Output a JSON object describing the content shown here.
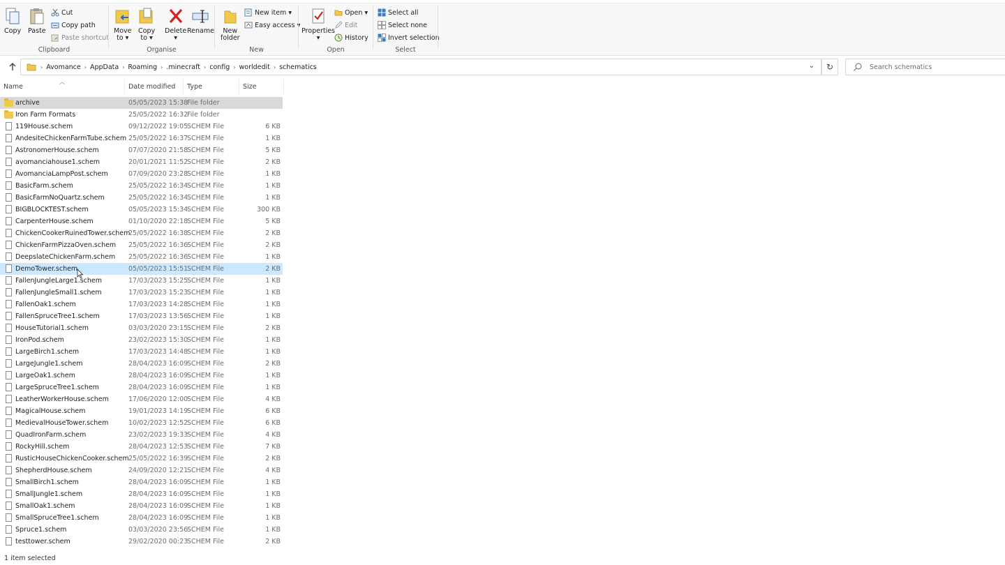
{
  "ribbon": {
    "clipboard": {
      "label": "Clipboard",
      "copy": "Copy",
      "paste": "Paste",
      "cut": "Cut",
      "copy_path": "Copy path",
      "paste_shortcut": "Paste shortcut"
    },
    "organise": {
      "label": "Organise",
      "move_to": "Move\nto",
      "move_to_l1": "Move",
      "move_to_l2": "to ▾",
      "copy_to_l1": "Copy",
      "copy_to_l2": "to ▾",
      "delete_l1": "Delete",
      "delete_l2": "▾",
      "rename": "Rename"
    },
    "new": {
      "label": "New",
      "new_folder_l1": "New",
      "new_folder_l2": "folder",
      "new_item": "New item ▾",
      "easy_access": "Easy access ▾"
    },
    "open": {
      "label": "Open",
      "properties_l1": "Properties",
      "properties_l2": "▾",
      "open": "Open ▾",
      "edit": "Edit",
      "history": "History"
    },
    "select": {
      "label": "Select",
      "select_all": "Select all",
      "select_none": "Select none",
      "invert_selection": "Invert selection"
    }
  },
  "address": {
    "crumbs": [
      "Avomance",
      "AppData",
      "Roaming",
      ".minecraft",
      "config",
      "worldedit",
      "schematics"
    ],
    "separator": "›"
  },
  "search": {
    "placeholder": "Search schematics"
  },
  "columns": {
    "name": "Name",
    "date": "Date modified",
    "type": "Type",
    "size": "Size"
  },
  "files": [
    {
      "name": "archive",
      "date": "05/05/2023 15:38",
      "type": "File folder",
      "size": "",
      "kind": "folder",
      "state": "selected-inactive"
    },
    {
      "name": "Iron Farm Formats",
      "date": "25/05/2022 16:32",
      "type": "File folder",
      "size": "",
      "kind": "folder"
    },
    {
      "name": "119House.schem",
      "date": "09/12/2022 19:05",
      "type": "SCHEM File",
      "size": "6 KB",
      "kind": "file"
    },
    {
      "name": "AndesiteChickenFarmTube.schem",
      "date": "25/05/2022 16:37",
      "type": "SCHEM File",
      "size": "1 KB",
      "kind": "file"
    },
    {
      "name": "AstronomerHouse.schem",
      "date": "07/07/2020 21:58",
      "type": "SCHEM File",
      "size": "5 KB",
      "kind": "file"
    },
    {
      "name": "avomanciahouse1.schem",
      "date": "20/01/2021 11:52",
      "type": "SCHEM File",
      "size": "2 KB",
      "kind": "file"
    },
    {
      "name": "AvomanciaLampPost.schem",
      "date": "07/09/2020 23:28",
      "type": "SCHEM File",
      "size": "1 KB",
      "kind": "file"
    },
    {
      "name": "BasicFarm.schem",
      "date": "25/05/2022 16:34",
      "type": "SCHEM File",
      "size": "1 KB",
      "kind": "file"
    },
    {
      "name": "BasicFarmNoQuartz.schem",
      "date": "25/05/2022 16:34",
      "type": "SCHEM File",
      "size": "1 KB",
      "kind": "file"
    },
    {
      "name": "BIGBLOCKTEST.schem",
      "date": "05/05/2023 15:34",
      "type": "SCHEM File",
      "size": "300 KB",
      "kind": "file"
    },
    {
      "name": "CarpenterHouse.schem",
      "date": "01/10/2020 22:18",
      "type": "SCHEM File",
      "size": "5 KB",
      "kind": "file"
    },
    {
      "name": "ChickenCookerRuinedTower.schem",
      "date": "25/05/2022 16:38",
      "type": "SCHEM File",
      "size": "2 KB",
      "kind": "file"
    },
    {
      "name": "ChickenFarmPizzaOven.schem",
      "date": "25/05/2022 16:36",
      "type": "SCHEM File",
      "size": "2 KB",
      "kind": "file"
    },
    {
      "name": "DeepslateChickenFarm.schem",
      "date": "25/05/2022 16:36",
      "type": "SCHEM File",
      "size": "1 KB",
      "kind": "file"
    },
    {
      "name": "DemoTower.schem",
      "date": "05/05/2023 15:51",
      "type": "SCHEM File",
      "size": "2 KB",
      "kind": "file",
      "state": "hover"
    },
    {
      "name": "FallenJungleLarge1.schem",
      "date": "17/03/2023 15:25",
      "type": "SCHEM File",
      "size": "1 KB",
      "kind": "file"
    },
    {
      "name": "FallenJungleSmall1.schem",
      "date": "17/03/2023 15:23",
      "type": "SCHEM File",
      "size": "1 KB",
      "kind": "file"
    },
    {
      "name": "FallenOak1.schem",
      "date": "17/03/2023 14:28",
      "type": "SCHEM File",
      "size": "1 KB",
      "kind": "file"
    },
    {
      "name": "FallenSpruceTree1.schem",
      "date": "17/03/2023 13:56",
      "type": "SCHEM File",
      "size": "1 KB",
      "kind": "file"
    },
    {
      "name": "HouseTutorial1.schem",
      "date": "03/03/2020 23:15",
      "type": "SCHEM File",
      "size": "2 KB",
      "kind": "file"
    },
    {
      "name": "IronPod.schem",
      "date": "23/02/2023 15:30",
      "type": "SCHEM File",
      "size": "1 KB",
      "kind": "file"
    },
    {
      "name": "LargeBirch1.schem",
      "date": "17/03/2023 14:48",
      "type": "SCHEM File",
      "size": "1 KB",
      "kind": "file"
    },
    {
      "name": "LargeJungle1.schem",
      "date": "28/04/2023 16:09",
      "type": "SCHEM File",
      "size": "2 KB",
      "kind": "file"
    },
    {
      "name": "LargeOak1.schem",
      "date": "28/04/2023 16:09",
      "type": "SCHEM File",
      "size": "1 KB",
      "kind": "file"
    },
    {
      "name": "LargeSpruceTree1.schem",
      "date": "28/04/2023 16:09",
      "type": "SCHEM File",
      "size": "1 KB",
      "kind": "file"
    },
    {
      "name": "LeatherWorkerHouse.schem",
      "date": "17/06/2020 12:00",
      "type": "SCHEM File",
      "size": "4 KB",
      "kind": "file"
    },
    {
      "name": "MagicalHouse.schem",
      "date": "19/01/2023 14:19",
      "type": "SCHEM File",
      "size": "6 KB",
      "kind": "file"
    },
    {
      "name": "MedievalHouseTower.schem",
      "date": "10/02/2023 12:52",
      "type": "SCHEM File",
      "size": "6 KB",
      "kind": "file"
    },
    {
      "name": "QuadIronFarm.schem",
      "date": "23/02/2023 19:33",
      "type": "SCHEM File",
      "size": "4 KB",
      "kind": "file"
    },
    {
      "name": "RockyHill.schem",
      "date": "28/04/2023 12:53",
      "type": "SCHEM File",
      "size": "7 KB",
      "kind": "file"
    },
    {
      "name": "RusticHouseChickenCooker.schem",
      "date": "25/05/2022 16:39",
      "type": "SCHEM File",
      "size": "2 KB",
      "kind": "file"
    },
    {
      "name": "ShepherdHouse.schem",
      "date": "24/09/2020 12:21",
      "type": "SCHEM File",
      "size": "4 KB",
      "kind": "file"
    },
    {
      "name": "SmallBirch1.schem",
      "date": "28/04/2023 16:09",
      "type": "SCHEM File",
      "size": "1 KB",
      "kind": "file"
    },
    {
      "name": "SmallJungle1.schem",
      "date": "28/04/2023 16:09",
      "type": "SCHEM File",
      "size": "1 KB",
      "kind": "file"
    },
    {
      "name": "SmallOak1.schem",
      "date": "28/04/2023 16:09",
      "type": "SCHEM File",
      "size": "1 KB",
      "kind": "file"
    },
    {
      "name": "SmallSpruceTree1.schem",
      "date": "28/04/2023 16:09",
      "type": "SCHEM File",
      "size": "1 KB",
      "kind": "file"
    },
    {
      "name": "Spruce1.schem",
      "date": "03/03/2020 23:56",
      "type": "SCHEM File",
      "size": "1 KB",
      "kind": "file"
    },
    {
      "name": "testtower.schem",
      "date": "29/02/2020 00:23",
      "type": "SCHEM File",
      "size": "2 KB",
      "kind": "file"
    }
  ],
  "status": {
    "text": "1 item selected"
  },
  "colors": {
    "selected_row": "#cce8ff",
    "inactive_selection": "#d9d9d9",
    "folder": "#f0c94c",
    "delete_red": "#d32020",
    "accent_blue": "#1e6fc4"
  }
}
